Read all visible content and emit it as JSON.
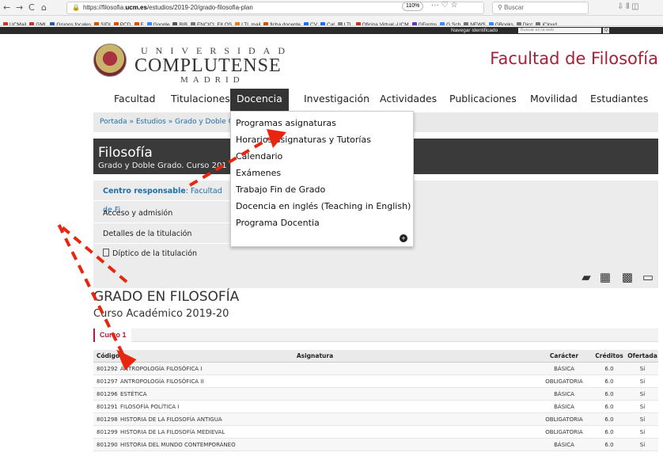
{
  "browser": {
    "back": "←",
    "forward": "→",
    "reload": "C",
    "home": "⌂",
    "url_prefix": "https://filosofia.",
    "url_domain": "ucm.es",
    "url_path": "/estudios/2019-20/grado-filosofia-plan",
    "zoom": "110%",
    "url_actions": "··· ♡ ☆",
    "search_placeholder": "Buscar",
    "tool_icons": "⇩ ⫴ ◫"
  },
  "bookmarks": [
    {
      "label": "UCMail",
      "color": "#c0392b"
    },
    {
      "label": "GML",
      "color": "#c0392b"
    },
    {
      "label": "Grupos focales",
      "color": "#2c5aa0"
    },
    {
      "label": "SIDI",
      "color": "#d35400"
    },
    {
      "label": "PCD",
      "color": "#d35400"
    },
    {
      "label": "F",
      "color": "#d35400"
    },
    {
      "label": "Google",
      "color": "#4285f4"
    },
    {
      "label": "BIB",
      "color": "#555555"
    },
    {
      "label": "ENCICL FILOS",
      "color": "#777777"
    },
    {
      "label": "LTL mail",
      "color": "#e67e22"
    },
    {
      "label": "ficha docente",
      "color": "#d35400"
    },
    {
      "label": "CV",
      "color": "#1a73e8"
    },
    {
      "label": "Cal",
      "color": "#1a73e8"
    },
    {
      "label": "LTL",
      "color": "#888888"
    },
    {
      "label": "Oficina Virtual -UCM",
      "color": "#c0392b"
    },
    {
      "label": "GForms",
      "color": "#673ab7"
    },
    {
      "label": "G Sch",
      "color": "#4285f4"
    },
    {
      "label": "NEWS",
      "color": "#777777"
    },
    {
      "label": "GBooks",
      "color": "#4285f4"
    },
    {
      "label": "Dicc",
      "color": "#777777"
    },
    {
      "label": "iCloud",
      "color": "#777777"
    }
  ],
  "site_strip": {
    "identified": "Navegar identificado",
    "search_placeholder": "Buscar en la web",
    "search_button": "Q"
  },
  "header": {
    "logo_top": "UNIVERSIDAD",
    "logo_mid": "COMPLUTENSE",
    "logo_bot": "MADRID",
    "faculty": "Facultad de Filosofía"
  },
  "mainnav": [
    {
      "label": "Facultad",
      "active": false
    },
    {
      "label": "Titulaciones",
      "active": false
    },
    {
      "label": "Docencia",
      "active": true
    },
    {
      "label": "Investigación",
      "active": false
    },
    {
      "label": "Actividades",
      "active": false
    },
    {
      "label": "Publicaciones",
      "active": false
    },
    {
      "label": "Movilidad",
      "active": false
    },
    {
      "label": "Estudiantes",
      "active": false
    }
  ],
  "breadcrumb": "Portada » Estudios » Grado y Doble Gr",
  "titleband": {
    "title": "Filosofía",
    "subtitle": "Grado y Doble Grado. Curso 201"
  },
  "info": {
    "centro_label": "Centro responsable",
    "centro_value": ": Facultad de Fi",
    "acceso": "Acceso y admisión",
    "detalles": "Detalles de la titulación",
    "diptico": "Díptico de la titulación"
  },
  "dropdown": {
    "items": [
      "Programas asignaturas",
      "Horarios asignaturas y Tutorías",
      "Calendario",
      "Exámenes",
      "Trabajo Fin de Grado",
      "Docencia en inglés (Teaching in English)",
      "Programa Docentia"
    ],
    "more": "+"
  },
  "section": {
    "grado": "GRADO EN FILOSOFÍA",
    "curso_academico": "Curso Académico 2019-20",
    "curso_tab": "Curso 1"
  },
  "table": {
    "headers": {
      "code": "Código",
      "name": "Asignatura",
      "caracter": "Carácter",
      "creditos": "Créditos",
      "oferta": "Ofertada"
    },
    "rows": [
      {
        "code": "801292",
        "name": "ANTROPOLOGÍA FILOSÓFICA I",
        "caracter": "BÁSICA",
        "creditos": "6.0",
        "oferta": "Sí"
      },
      {
        "code": "801297",
        "name": "ANTROPOLOGÍA FILOSÓFICA II",
        "caracter": "OBLIGATORIA",
        "creditos": "6.0",
        "oferta": "Sí"
      },
      {
        "code": "801296",
        "name": "ESTÉTICA",
        "caracter": "BÁSICA",
        "creditos": "6.0",
        "oferta": "Sí"
      },
      {
        "code": "801291",
        "name": "FILOSOFÍA POLÍTICA I",
        "caracter": "BÁSICA",
        "creditos": "6.0",
        "oferta": "Sí"
      },
      {
        "code": "801298",
        "name": "HISTORIA DE LA FILOSOFÍA ANTIGUA",
        "caracter": "OBLIGATORIA",
        "creditos": "6.0",
        "oferta": "Sí"
      },
      {
        "code": "801299",
        "name": "HISTORIA DE LA FILOSOFÍA MEDIEVAL",
        "caracter": "OBLIGATORIA",
        "creditos": "6.0",
        "oferta": "Sí"
      },
      {
        "code": "801290",
        "name": "HISTORIA DEL MUNDO CONTEMPORÁNEO",
        "caracter": "BÁSICA",
        "creditos": "6.0",
        "oferta": "Sí"
      }
    ]
  },
  "colors": {
    "accent": "#a6203a",
    "link": "#1d6fa8",
    "dark_band": "#3a3a3a",
    "annotation": "#e8250f"
  }
}
